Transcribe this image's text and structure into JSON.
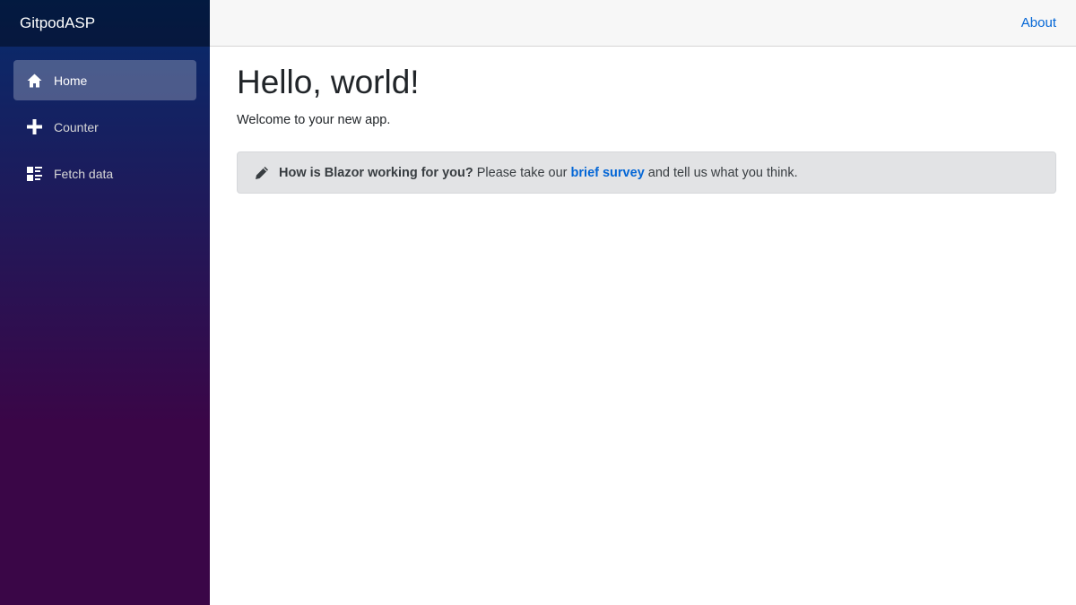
{
  "sidebar": {
    "brand": "GitpodASP",
    "items": [
      {
        "label": "Home",
        "icon": "home-icon",
        "active": true
      },
      {
        "label": "Counter",
        "icon": "plus-icon",
        "active": false
      },
      {
        "label": "Fetch data",
        "icon": "list-rich-icon",
        "active": false
      }
    ]
  },
  "header": {
    "about_label": "About"
  },
  "main": {
    "title": "Hello, world!",
    "welcome": "Welcome to your new app.",
    "survey": {
      "icon": "pencil-icon",
      "question": "How is Blazor working for you?",
      "prefix": " Please take our ",
      "link": "brief survey",
      "suffix": " and tell us what you think."
    }
  },
  "colors": {
    "sidebar_top": "#062c6c",
    "sidebar_bottom": "#3a0647",
    "link": "#0366d6",
    "alert_bg": "#e2e3e5"
  }
}
